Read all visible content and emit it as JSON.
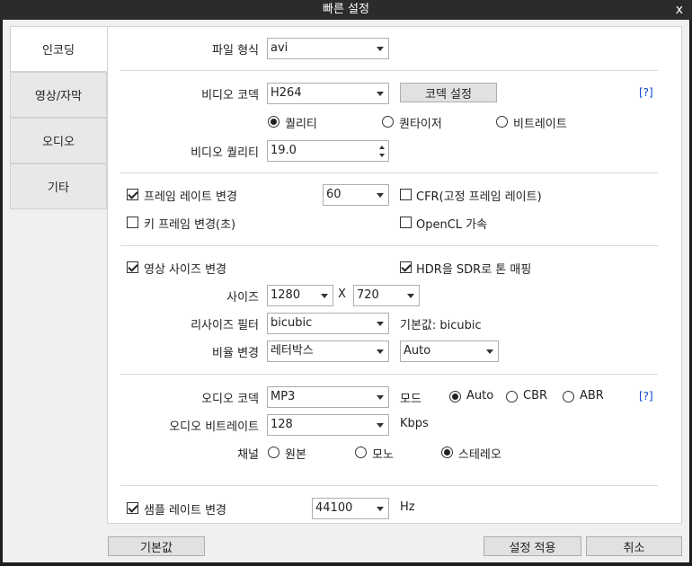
{
  "window": {
    "title": "빠른 설정",
    "close_glyph": "x"
  },
  "tabs": [
    "인코딩",
    "영상/자막",
    "오디오",
    "기타"
  ],
  "file_format": {
    "label": "파일 형식",
    "value": "avi"
  },
  "video": {
    "codec_label": "비디오 코덱",
    "codec_value": "H264",
    "codec_settings_button": "코덱 설정",
    "help": "[?]",
    "modes": [
      "퀄리티",
      "퀀타이저",
      "비트레이트"
    ],
    "selected_mode": 0,
    "quality_label": "비디오 퀄리티",
    "quality_value": "19.0"
  },
  "framerate": {
    "change_label": "프레임 레이트 변경",
    "change_checked": true,
    "value": "60",
    "cfr_label": "CFR(고정 프레임 레이트)",
    "cfr_checked": false,
    "keyframe_label": "키 프레임 변경(초)",
    "keyframe_checked": false,
    "opencl_label": "OpenCL 가속",
    "opencl_checked": false
  },
  "size": {
    "change_label": "영상 사이즈 변경",
    "change_checked": true,
    "hdr_label": "HDR을 SDR로 톤 매핑",
    "hdr_checked": true,
    "size_label": "사이즈",
    "width": "1280",
    "x_label": "X",
    "height": "720",
    "filter_label": "리사이즈 필터",
    "filter_value": "bicubic",
    "filter_default": "기본값: bicubic",
    "ratio_label": "비율 변경",
    "ratio_value": "레터박스",
    "ratio_mode": "Auto"
  },
  "audio": {
    "codec_label": "오디오 코덱",
    "codec_value": "MP3",
    "mode_label": "모드",
    "modes": [
      "Auto",
      "CBR",
      "ABR"
    ],
    "selected_mode": 0,
    "help": "[?]",
    "bitrate_label": "오디오 비트레이트",
    "bitrate_value": "128",
    "bitrate_unit": "Kbps",
    "channel_label": "채널",
    "channels": [
      "원본",
      "모노",
      "스테레오"
    ],
    "selected_channel": 2
  },
  "samplerate": {
    "label": "샘플 레이트 변경",
    "checked": true,
    "value": "44100",
    "unit": "Hz"
  },
  "footer": {
    "default_button": "기본값",
    "apply_button": "설정 적용",
    "cancel_button": "취소"
  }
}
